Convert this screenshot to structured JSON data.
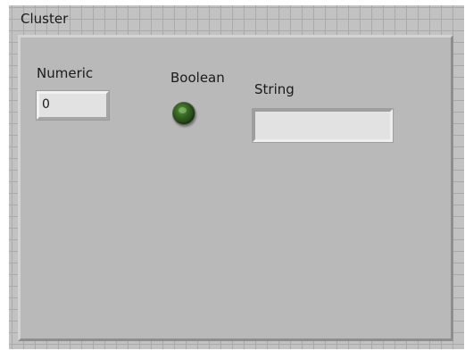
{
  "cluster": {
    "label": "Cluster"
  },
  "controls": {
    "numeric": {
      "label": "Numeric",
      "value": "0"
    },
    "boolean": {
      "label": "Boolean",
      "state": "off",
      "led_color": "#2e5a1c"
    },
    "string": {
      "label": "String",
      "value": ""
    }
  },
  "colors": {
    "panel_background": "#c2c2c2",
    "grid_lines": "#a9a9a9",
    "cluster_background": "#b9b9b9",
    "control_background": "#e2e2e2"
  }
}
